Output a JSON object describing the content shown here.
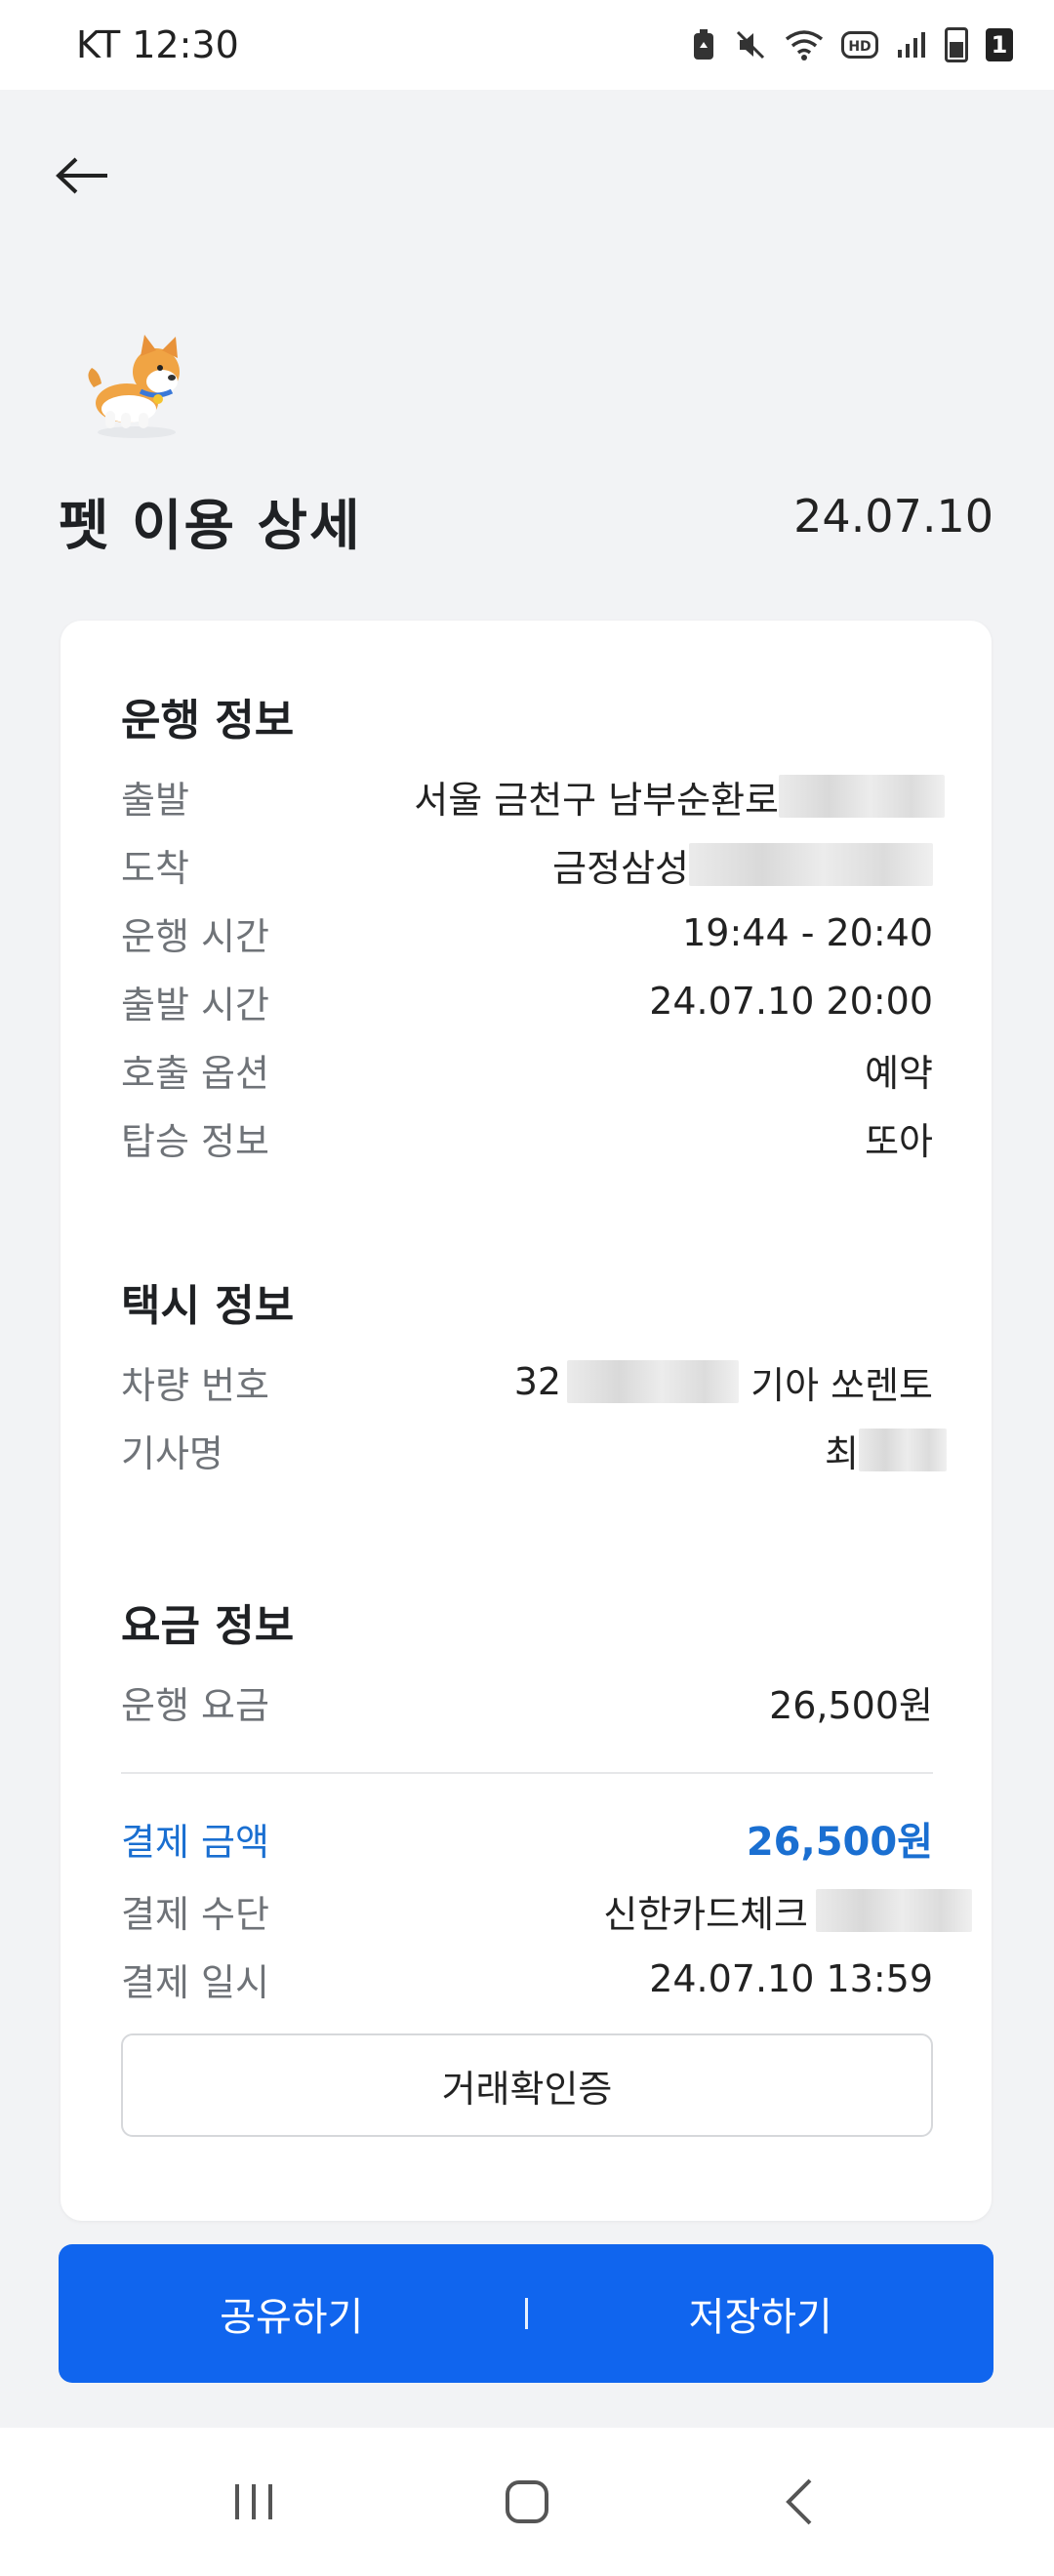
{
  "status_bar": {
    "carrier_time": "KT 12:30",
    "sim_number": "1",
    "icons": [
      "battery-saver-icon",
      "mute-icon",
      "wifi-icon",
      "hd-icon",
      "signal-icon",
      "battery-icon"
    ]
  },
  "header": {
    "back_icon": "arrow-left-icon",
    "title": "펫 이용 상세",
    "date": "24.07.10"
  },
  "ride_info": {
    "title": "운행 정보",
    "rows": [
      {
        "label": "출발",
        "value": "서울 금천구 남부순환로"
      },
      {
        "label": "도착",
        "value": "금정삼성"
      },
      {
        "label": "운행 시간",
        "value": "19:44 - 20:40"
      },
      {
        "label": "출발 시간",
        "value": "24.07.10 20:00"
      },
      {
        "label": "호출 옵션",
        "value": "예약"
      },
      {
        "label": "탑승 정보",
        "value": "또아"
      }
    ]
  },
  "taxi_info": {
    "title": "택시 정보",
    "rows": [
      {
        "label": "차량 번호",
        "value_prefix": "32",
        "value_suffix": "기아 쏘렌토"
      },
      {
        "label": "기사명",
        "value": "최"
      }
    ]
  },
  "fare_info": {
    "title": "요금 정보",
    "fare_label": "운행 요금",
    "fare_value": "26,500원",
    "pay_label": "결제 금액",
    "pay_value": "26,500원",
    "method_label": "결제 수단",
    "method_value": "신한카드체크",
    "paid_at_label": "결제 일시",
    "paid_at_value": "24.07.10 13:59",
    "confirm_button": "거래확인증"
  },
  "actions": {
    "share": "공유하기",
    "save": "저장하기"
  },
  "colors": {
    "primary": "#1065ee",
    "pay_accent": "#1a6fd1",
    "background": "#f2f3f5"
  }
}
